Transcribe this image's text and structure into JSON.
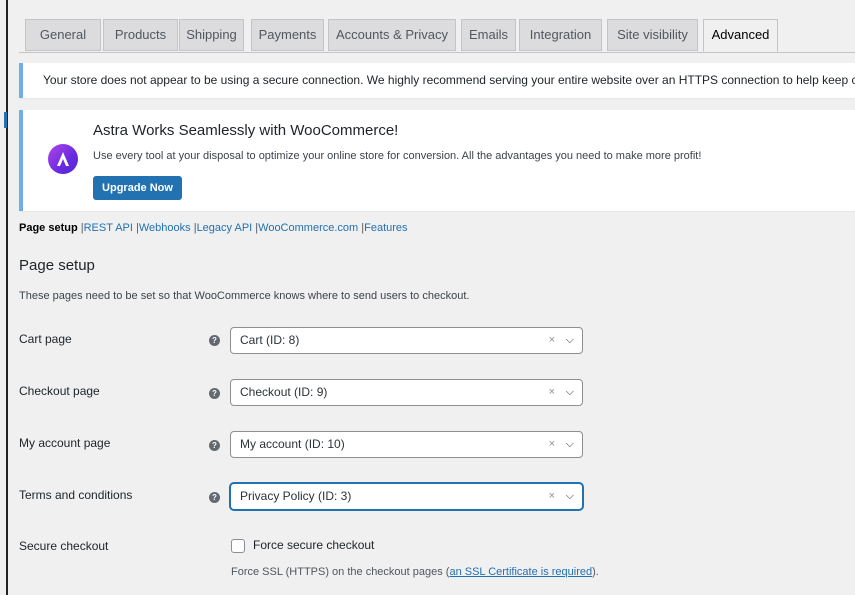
{
  "tabs": [
    {
      "label": "General"
    },
    {
      "label": "Products"
    },
    {
      "label": "Shipping"
    },
    {
      "label": "Payments"
    },
    {
      "label": "Accounts & Privacy"
    },
    {
      "label": "Emails"
    },
    {
      "label": "Integration"
    },
    {
      "label": "Site visibility"
    },
    {
      "label": "Advanced",
      "active": true
    }
  ],
  "notice": {
    "text": "Your store does not appear to be using a secure connection. We highly recommend serving your entire website over an HTTPS connection to help keep customer data secure."
  },
  "promo": {
    "logo_icon": "astra-logo-icon",
    "logo_glyph": "Λ",
    "title": "Astra Works Seamlessly with WooCommerce!",
    "text": "Use every tool at your disposal to optimize your online store for conversion. All the advantages you need to make more profit!",
    "button": "Upgrade Now"
  },
  "subnav": {
    "current": "Page setup",
    "links": [
      "REST API",
      "Webhooks",
      "Legacy API",
      "WooCommerce.com",
      "Features"
    ],
    "separator": "|"
  },
  "page_setup": {
    "title": "Page setup",
    "description": "These pages need to be set so that WooCommerce knows where to send users to checkout.",
    "help_glyph": "?",
    "clear_glyph": "×",
    "chevron_glyph": "⌵",
    "rows": [
      {
        "label": "Cart page",
        "value": "Cart (ID: 8)"
      },
      {
        "label": "Checkout page",
        "value": "Checkout (ID: 9)"
      },
      {
        "label": "My account page",
        "value": "My account (ID: 10)"
      },
      {
        "label": "Terms and conditions",
        "value": "Privacy Policy (ID: 3)",
        "focused": true
      }
    ]
  },
  "secure_checkout": {
    "label": "Secure checkout",
    "checkbox_label": "Force secure checkout",
    "checked": false,
    "desc_prefix": "Force SSL (HTTPS) on the checkout pages (",
    "desc_link": "an SSL Certificate is required",
    "desc_suffix": ")."
  },
  "colors": {
    "accent": "#2271b1",
    "notice_border": "#72aee6",
    "background": "#f0f0f1"
  }
}
